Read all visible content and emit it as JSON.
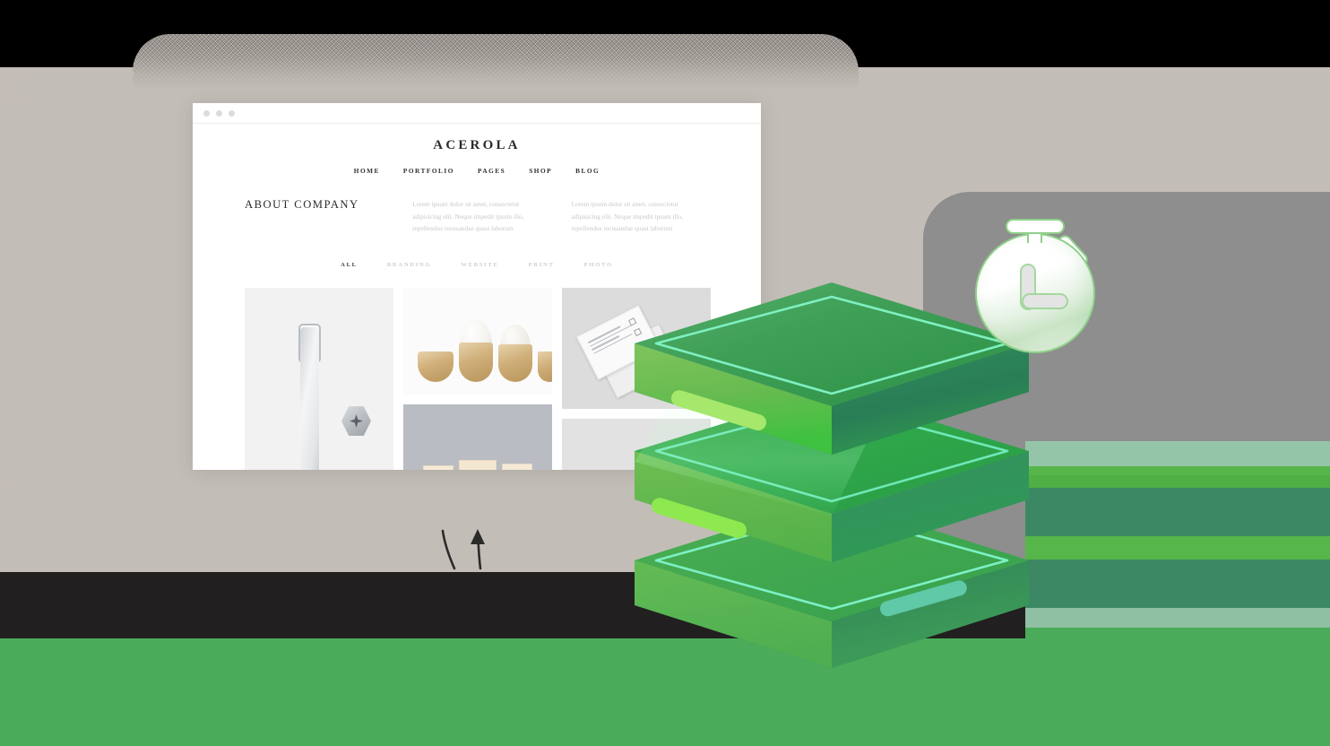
{
  "scene": {
    "title": "Speed / performance hero illustration",
    "background_bands": [
      {
        "name": "taupe",
        "color": "#c3bdb7"
      },
      {
        "name": "dark",
        "color": "#211f1f"
      },
      {
        "name": "green",
        "color": "#4aab5a"
      }
    ],
    "accent_color": "#4aab5a",
    "shadow_color": "#8e8e8e"
  },
  "browser": {
    "chrome_dots": 3,
    "site": {
      "logo": "ACEROLA",
      "nav": [
        {
          "label": "HOME"
        },
        {
          "label": "PORTFOLIO"
        },
        {
          "label": "PAGES"
        },
        {
          "label": "SHOP"
        },
        {
          "label": "BLOG"
        }
      ],
      "about": {
        "heading": "ABOUT COMPANY",
        "columns": [
          "Lorem ipsum dolor sit amet, consectetur adipisicing elit. Neque impedit ipsum illo, repellendus recusandae quasi laborum",
          "Lorem ipsum dolor sit amet, consectetur adipisicing elit. Neque impedit ipsum illo, repellendus recusandae quasi laborum"
        ]
      },
      "filters": [
        {
          "label": "ALL",
          "active": true
        },
        {
          "label": "BRANDING",
          "active": false
        },
        {
          "label": "WEBSITE",
          "active": false
        },
        {
          "label": "PRINT",
          "active": false
        },
        {
          "label": "PHOTO",
          "active": false
        }
      ],
      "portfolio": [
        {
          "name": "pen-and-screw-photo"
        },
        {
          "name": "wooden-egg-cups-photo"
        },
        {
          "name": "stationery-cards-photo"
        },
        {
          "name": "business-cards-photo"
        },
        {
          "name": "grey-product-photo"
        }
      ]
    }
  },
  "illustration": {
    "name": "stacked-database-layers",
    "layer_count": 3,
    "layers": [
      {
        "name": "layer-top",
        "top_color": "#3f9a55",
        "left_color": "#6fc053",
        "right_color": "#2e7d57",
        "outline_color": "#7ef0c0",
        "pill_color": "#a6e86c"
      },
      {
        "name": "layer-middle",
        "top_color": "#2fa84a",
        "left_color": "#67bb4f",
        "right_color": "#338a5d",
        "outline_color": "#6fe8b8",
        "pill_color": "#8ee84f"
      },
      {
        "name": "layer-bottom",
        "top_color": "#41a84f",
        "left_color": "#5cb554",
        "right_color": "#2f8359",
        "outline_color": "#7df0c4",
        "pill_color": "#5fc9a8"
      }
    ],
    "badge": {
      "name": "stopwatch-icon",
      "ring_color": "#8fd08a",
      "hand_color": "#e4e4e4"
    },
    "doodles": [
      {
        "name": "curved-stroke"
      },
      {
        "name": "up-arrow"
      }
    ]
  }
}
